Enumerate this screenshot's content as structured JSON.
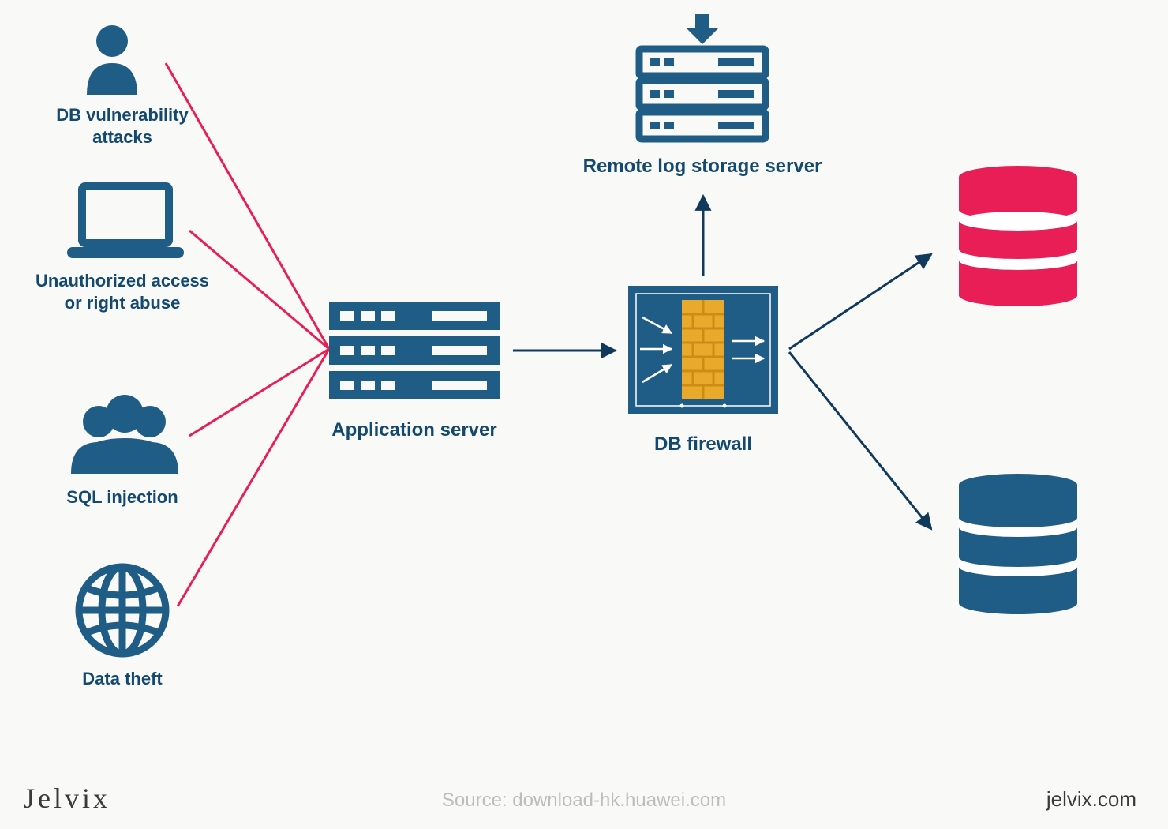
{
  "colors": {
    "blue": "#1f5d86",
    "red": "#e91e56",
    "dark": "#11395b",
    "orange": "#e9a92a",
    "orange_line": "#cc8d17",
    "grey": "#bdbdbd"
  },
  "threats": {
    "db_vuln": "DB vulnerability\nattacks",
    "unauth": "Unauthorized access\nor right abuse",
    "sql": "SQL injection",
    "theft": "Data theft"
  },
  "nodes": {
    "app_server": "Application server",
    "remote_log": "Remote log storage server",
    "db_firewall": "DB firewall"
  },
  "footer": {
    "brand": "Jelvix",
    "source": "Source: download-hk.huawei.com",
    "site": "jelvix.com"
  }
}
